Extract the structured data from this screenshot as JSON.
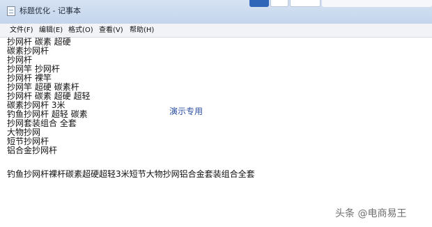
{
  "window": {
    "title": "标题优化 - 记事本"
  },
  "menu": [
    {
      "label": "文件(F)"
    },
    {
      "label": "编辑(E)"
    },
    {
      "label": "格式(O)"
    },
    {
      "label": "查看(V)"
    },
    {
      "label": "帮助(H)"
    }
  ],
  "editor": {
    "lines": [
      "抄网杆 碳素 超硬",
      "碳素抄网杆",
      "抄网杆",
      "抄网竿 抄网杆",
      "抄网杆 裸竿",
      "抄网竿 超硬 碳素杆",
      "抄网杆 碳素 超硬 超轻",
      "碳素抄网杆 3米",
      "钓鱼抄网杆 超轻 碳素",
      "抄网套装组合 全套",
      "大物抄网",
      "短节抄网杆",
      "铝合金抄网杆",
      "钓鱼抄网杆裸杆碳素超硬超轻3米短节大物抄网铝合金套装组合全套"
    ],
    "overlay_label": "演示专用"
  },
  "watermark": "头条 @电商易王",
  "colors": {
    "titlebar": "#c9d9ee",
    "menubar": "#f1f3f7",
    "editor_bg": "#ffffff",
    "overlay_text": "#2c4fa3",
    "minimize_button": "#2f66b8"
  },
  "icons": {
    "app": "notepad-icon"
  }
}
